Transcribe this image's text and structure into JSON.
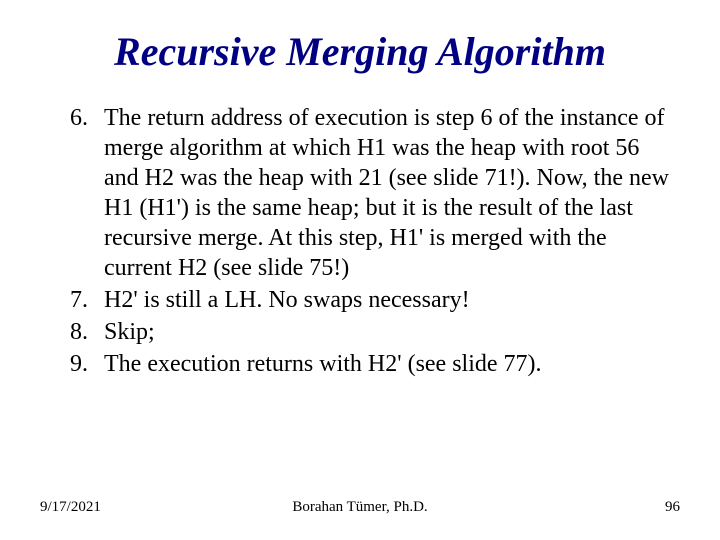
{
  "title": "Recursive Merging Algorithm",
  "items": [
    {
      "n": "6.",
      "t": "The return address of execution is step 6 of the instance of merge algorithm at which H1 was the heap with root 56 and H2 was the heap with 21 (see slide 71!).  Now, the new H1 (H1') is the same heap; but it is the result of the last recursive merge. At this step, H1' is merged with the current H2 (see slide 75!)"
    },
    {
      "n": "7.",
      "t": "H2' is still a LH.  No swaps necessary!"
    },
    {
      "n": "8.",
      "t": "Skip;"
    },
    {
      "n": "9.",
      "t": "The execution returns with H2' (see slide 77)."
    }
  ],
  "footer": {
    "date": "9/17/2021",
    "author": "Borahan Tümer, Ph.D.",
    "page": "96"
  }
}
